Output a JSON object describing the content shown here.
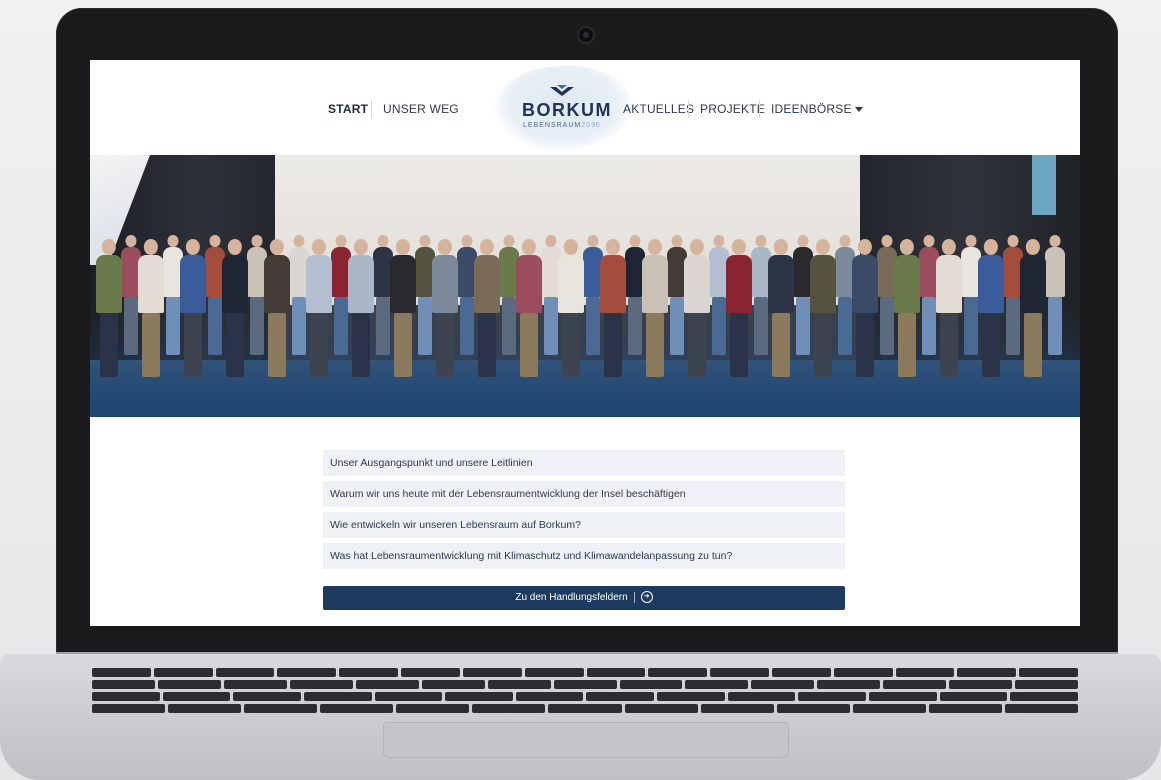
{
  "nav": {
    "items": [
      {
        "label": "START",
        "active": true
      },
      {
        "label": "UNSER WEG",
        "active": false
      },
      {
        "label": "AKTUELLES",
        "active": false
      },
      {
        "label": "PROJEKTE",
        "active": false
      },
      {
        "label": "IDEENBÖRSE",
        "active": false,
        "has_dropdown": true
      }
    ]
  },
  "logo": {
    "title": "BORKUM",
    "subtitle_main": "LEBENSRAUM",
    "subtitle_year": "2030"
  },
  "hero": {
    "icon": "accessibility-icon"
  },
  "accordion": {
    "items": [
      "Unser Ausgangspunkt und unsere Leitlinien",
      "Warum wir uns heute mit der Lebensraumentwicklung der Insel beschäftigen",
      "Wie entwickeln wir unseren Lebensraum auf Borkum?",
      "Was hat Lebensraumentwicklung mit Klimaschutz und Klimawandelanpassung zu tun?"
    ]
  },
  "cta": {
    "label": "Zu den Handlungsfeldern",
    "icon": "arrow-circle-right-icon"
  },
  "colors": {
    "brand_dark": "#1d3a5f",
    "accordion_bg": "#eef1f5",
    "accessibility": "#1d3e66"
  }
}
